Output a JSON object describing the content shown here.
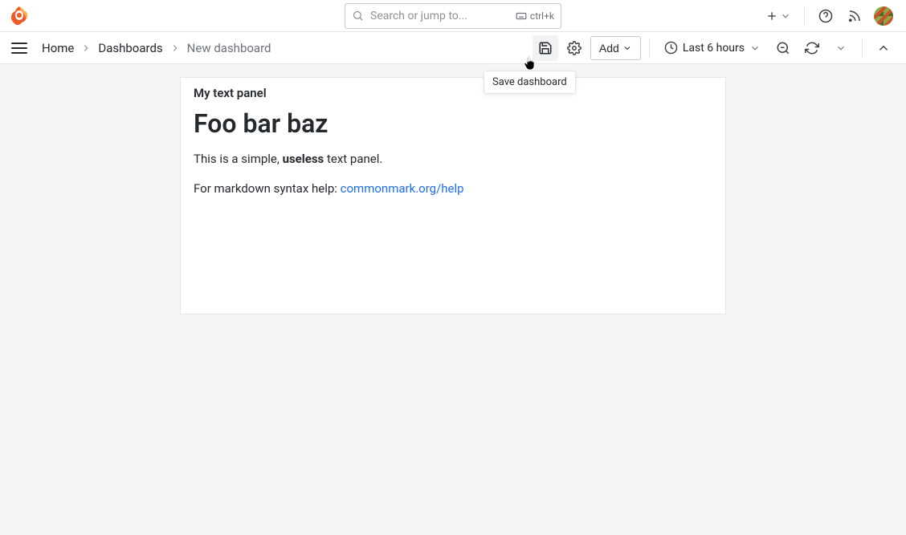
{
  "topbar": {
    "search_placeholder": "Search or jump to...",
    "shortcut": "ctrl+k"
  },
  "breadcrumbs": {
    "home": "Home",
    "dashboards": "Dashboards",
    "current": "New dashboard"
  },
  "toolbar": {
    "add_label": "Add",
    "time_label": "Last 6 hours",
    "save_tooltip": "Save dashboard"
  },
  "panel": {
    "title": "My text panel",
    "heading": "Foo bar baz",
    "para_prefix": "This is a simple, ",
    "para_bold": "useless",
    "para_suffix": " text panel.",
    "help_prefix": "For markdown syntax help: ",
    "help_link_text": "commonmark.org/help"
  }
}
